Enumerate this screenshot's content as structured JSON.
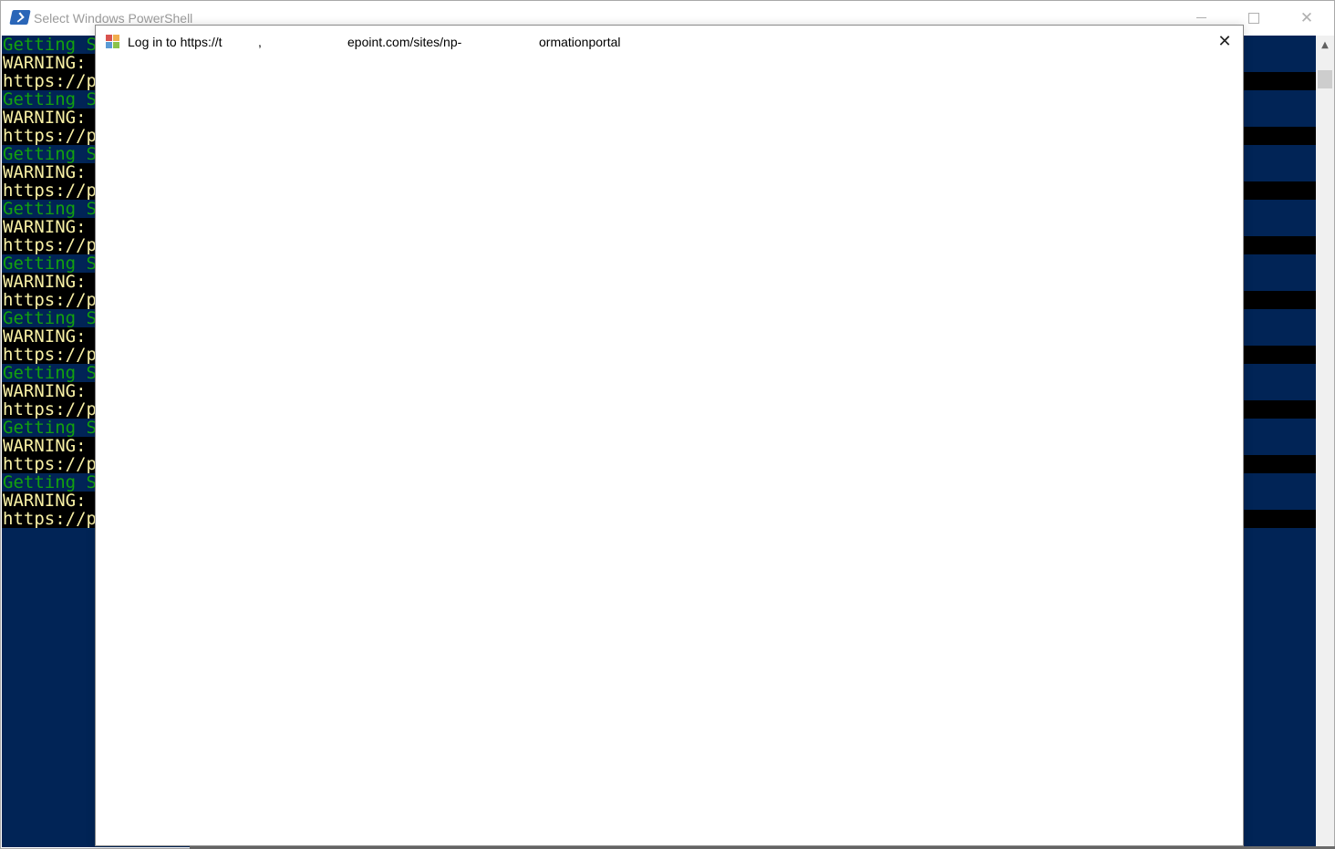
{
  "powershell_window": {
    "title": "Select Windows PowerShell",
    "icon": "powershell-icon",
    "caption_buttons": {
      "minimize": "minimize-icon",
      "maximize": "maximize-icon",
      "close_glyph": "✕"
    },
    "console_background": "#012456",
    "console_lines": [
      {
        "kind": "getting",
        "text": "Getting S"
      },
      {
        "kind": "warning",
        "text": "WARNING: "
      },
      {
        "kind": "url",
        "text": "https://p"
      },
      {
        "kind": "getting",
        "text": "Getting S"
      },
      {
        "kind": "warning",
        "text": "WARNING: "
      },
      {
        "kind": "url",
        "text": "https://p"
      },
      {
        "kind": "getting",
        "text": "Getting S"
      },
      {
        "kind": "warning",
        "text": "WARNING: "
      },
      {
        "kind": "url",
        "text": "https://p"
      },
      {
        "kind": "getting",
        "text": "Getting S"
      },
      {
        "kind": "warning",
        "text": "WARNING: "
      },
      {
        "kind": "url",
        "text": "https://p"
      },
      {
        "kind": "getting",
        "text": "Getting S"
      },
      {
        "kind": "warning",
        "text": "WARNING: "
      },
      {
        "kind": "url",
        "text": "https://p"
      },
      {
        "kind": "getting",
        "text": "Getting S"
      },
      {
        "kind": "warning",
        "text": "WARNING: "
      },
      {
        "kind": "url",
        "text": "https://p"
      },
      {
        "kind": "getting",
        "text": "Getting S"
      },
      {
        "kind": "warning",
        "text": "WARNING: "
      },
      {
        "kind": "url",
        "text": "https://p"
      },
      {
        "kind": "getting",
        "text": "Getting S"
      },
      {
        "kind": "warning",
        "text": "WARNING: "
      },
      {
        "kind": "url",
        "text": "https://p"
      },
      {
        "kind": "getting",
        "text": "Getting S"
      },
      {
        "kind": "warning",
        "text": "WARNING: "
      },
      {
        "kind": "url",
        "text": "https://p"
      }
    ],
    "colors": {
      "getting_text": "#13a10e",
      "warning_text": "#f9f1a5",
      "warning_background": "#000000"
    }
  },
  "login_dialog": {
    "title_segments": [
      "Log in to https://t",
      ",",
      "epoint.com/sites/np-",
      "ormationportal"
    ],
    "icon": "app-window-icon",
    "close_glyph": "✕"
  }
}
